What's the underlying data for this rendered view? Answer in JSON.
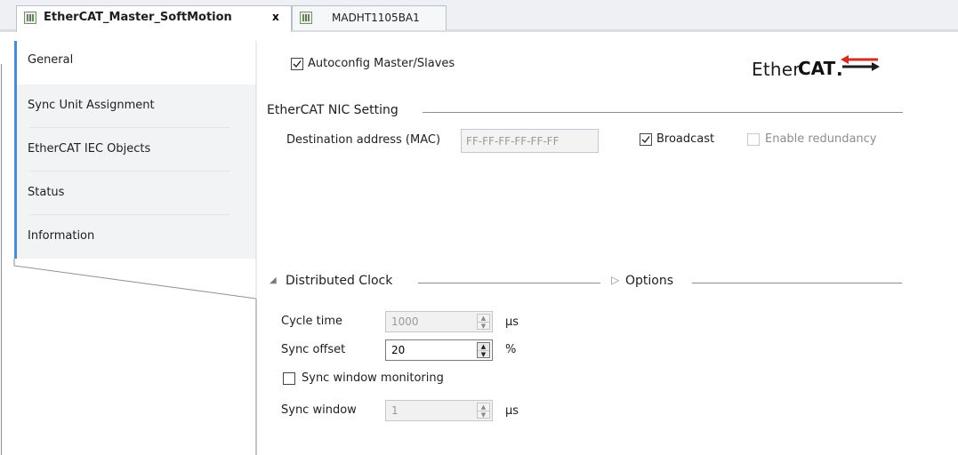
{
  "tabs": [
    {
      "label": "EtherCAT_Master_SoftMotion",
      "active": true,
      "close": "x"
    },
    {
      "label": "MADHT1105BA1",
      "active": false
    }
  ],
  "sidebar": {
    "items": [
      {
        "label": "General",
        "selected": true
      },
      {
        "label": "Sync Unit Assignment"
      },
      {
        "label": "EtherCAT IEC Objects"
      },
      {
        "label": "Status"
      },
      {
        "label": "Information"
      }
    ]
  },
  "general": {
    "autoconfig": {
      "label": "Autoconfig Master/Slaves",
      "checked": true
    },
    "logo": {
      "part1": "Ether",
      "part2": "CAT",
      "mark": "."
    },
    "nic": {
      "title": "EtherCAT NIC Setting",
      "destination_label": "Destination address (MAC)",
      "destination_value": "FF-FF-FF-FF-FF-FF",
      "broadcast": {
        "label": "Broadcast",
        "checked": true
      },
      "redundancy": {
        "label": "Enable redundancy",
        "checked": false,
        "enabled": false
      }
    },
    "dc": {
      "title": "Distributed Clock",
      "expand_icon": "◢",
      "cycle_time": {
        "label": "Cycle time",
        "value": "1000",
        "unit": "µs",
        "enabled": false
      },
      "sync_offset": {
        "label": "Sync offset",
        "value": "20",
        "unit": "%",
        "enabled": true
      },
      "sync_window_monitoring": {
        "label": "Sync window monitoring",
        "checked": false
      },
      "sync_window": {
        "label": "Sync window",
        "value": "1",
        "unit": "µs",
        "enabled": false
      }
    },
    "options": {
      "title": "Options",
      "expand_icon": "▷"
    }
  },
  "colors": {
    "accent": "#4a8bd6",
    "tab_border": "#b9c0c9",
    "logo_arrow": "#d62b20"
  }
}
